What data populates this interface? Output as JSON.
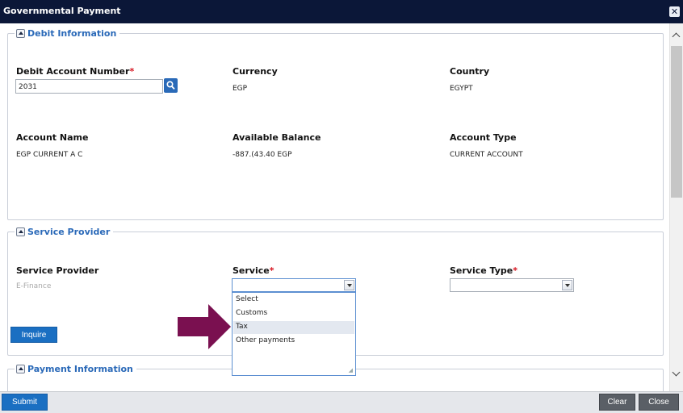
{
  "window": {
    "title": "Governmental Payment"
  },
  "debit": {
    "legend": "Debit Information",
    "account_number_label": "Debit Account Number",
    "account_number_value": "2031",
    "currency_label": "Currency",
    "currency_value": "EGP",
    "country_label": "Country",
    "country_value": "EGYPT",
    "account_name_label": "Account Name",
    "account_name_value": "EGP CURRENT A C",
    "balance_label": "Available Balance",
    "balance_value": "-887.(43.40 EGP",
    "account_type_label": "Account Type",
    "account_type_value": "CURRENT ACCOUNT"
  },
  "provider": {
    "legend": "Service Provider",
    "provider_label": "Service Provider",
    "provider_value": "E-Finance",
    "service_label": "Service",
    "service_options": [
      "Select",
      "Customs",
      "Tax",
      "Other payments"
    ],
    "service_type_label": "Service Type",
    "inquire_label": "Inquire"
  },
  "payment": {
    "legend": "Payment Information"
  },
  "required_marker": "*",
  "footer": {
    "submit_label": "Submit",
    "clear_label": "Clear",
    "close_label": "Close"
  },
  "colors": {
    "title_bar": "#0b1738",
    "accent_blue": "#1a6fc2",
    "legend_blue": "#2a69b8",
    "arrow": "#7a1050"
  }
}
